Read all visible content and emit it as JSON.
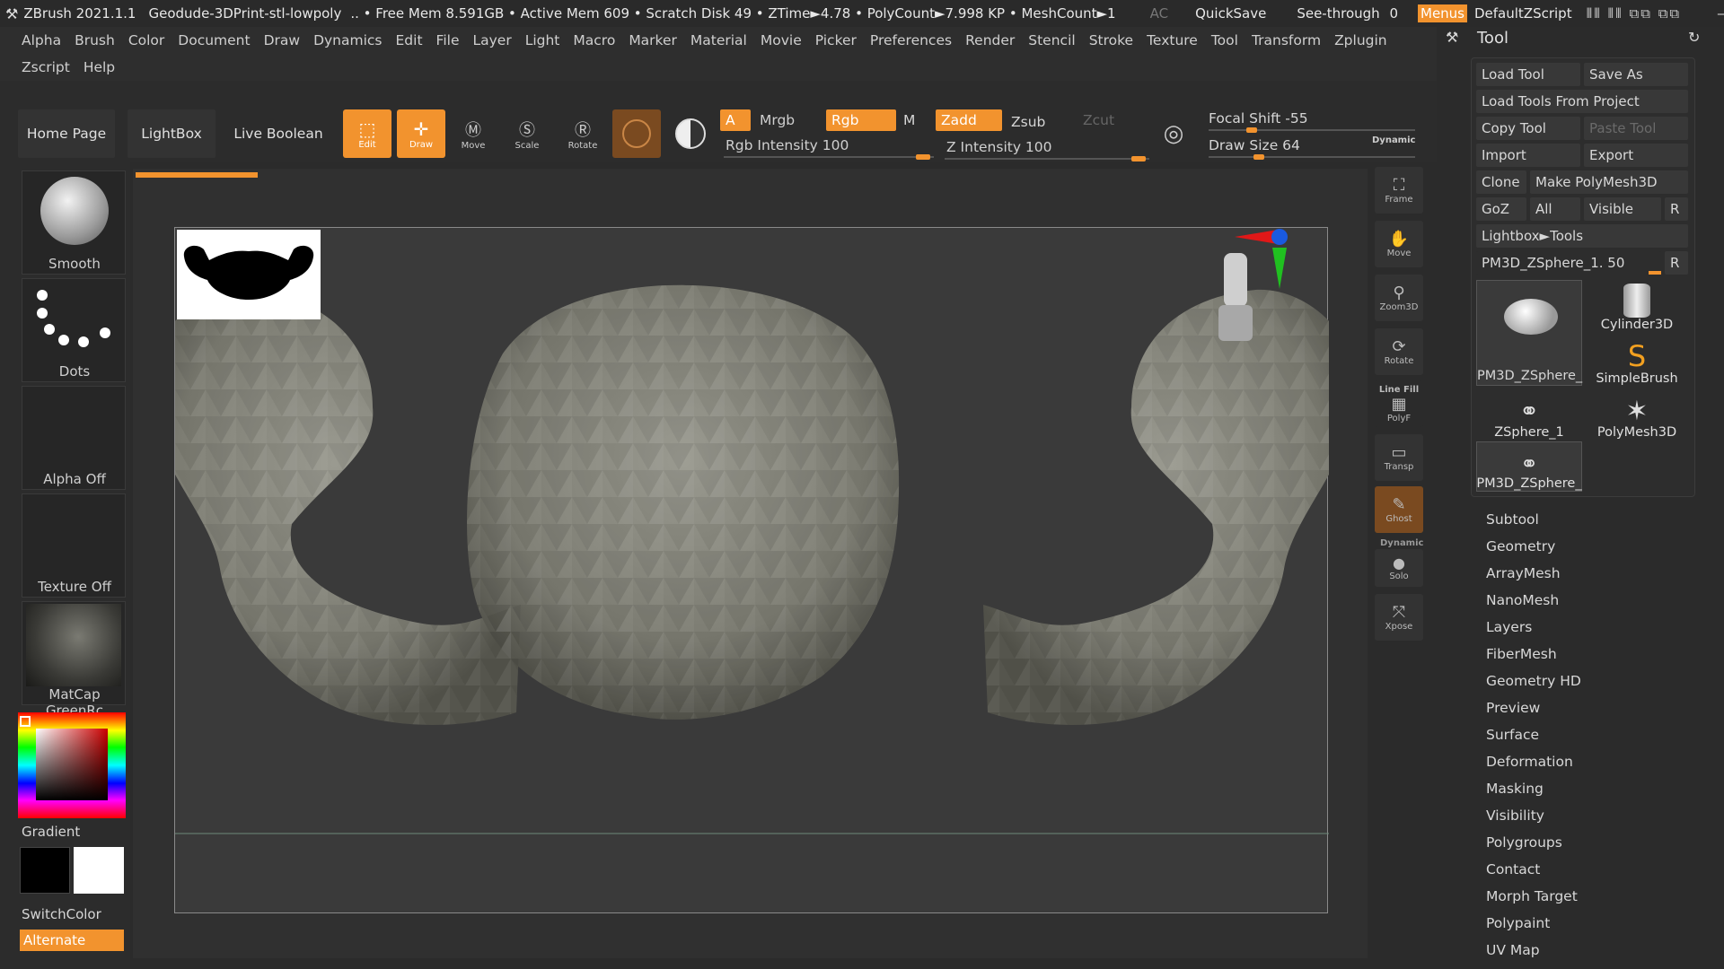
{
  "titlebar": {
    "app": "ZBrush 2021.1.1",
    "document": "Geodude-3DPrint-stl-lowpoly",
    "stats": ".. • Free Mem 8.591GB • Active Mem 609 • Scratch Disk 49 • ZTime►4.78 • PolyCount►7.998 KP • MeshCount►1",
    "ac": "AC",
    "quicksave": "QuickSave",
    "see_through_label": "See-through",
    "see_through_value": "0",
    "menus": "Menus",
    "script": "DefaultZScript"
  },
  "menu_row1": [
    "Alpha",
    "Brush",
    "Color",
    "Document",
    "Draw",
    "Dynamics",
    "Edit",
    "File",
    "Layer",
    "Light",
    "Macro",
    "Marker",
    "Material",
    "Movie",
    "Picker",
    "Preferences",
    "Render",
    "Stencil",
    "Stroke",
    "Texture",
    "Tool",
    "Transform",
    "Zplugin"
  ],
  "menu_row2": [
    "Zscript",
    "Help"
  ],
  "toolbar": {
    "home": "Home Page",
    "lightbox": "LightBox",
    "live_boolean": "Live Boolean",
    "edit": "Edit",
    "draw": "Draw",
    "move": "Move",
    "scale": "Scale",
    "rotate": "Rotate",
    "a": "A",
    "mrgb": "Mrgb",
    "rgb": "Rgb",
    "m": "M",
    "zadd": "Zadd",
    "zsub": "Zsub",
    "zcut": "Zcut",
    "rgb_intensity": "Rgb Intensity 100",
    "z_intensity": "Z Intensity 100",
    "focal_shift": "Focal Shift -55",
    "draw_size": "Draw Size 64",
    "dynamic": "Dynamic"
  },
  "left": {
    "smooth": "Smooth",
    "dots": "Dots",
    "alpha_off": "Alpha Off",
    "texture_off": "Texture Off",
    "matcap": "MatCap GreenRc",
    "gradient": "Gradient",
    "switchcolor": "SwitchColor",
    "alternate": "Alternate"
  },
  "right_strip": [
    "Frame",
    "Move",
    "Zoom3D",
    "Rotate",
    "Line Fill",
    "PolyF",
    "Transp",
    "Ghost",
    "Dynamic",
    "Solo",
    "Xpose"
  ],
  "tool_panel": {
    "title": "Tool",
    "load_tool": "Load Tool",
    "save_as": "Save As",
    "load_from_project": "Load Tools From Project",
    "copy_tool": "Copy Tool",
    "paste_tool": "Paste Tool",
    "import": "Import",
    "export": "Export",
    "clone": "Clone",
    "make_polymesh": "Make PolyMesh3D",
    "goz": "GoZ",
    "all": "All",
    "visible": "Visible",
    "r": "R",
    "lightbox_tools": "Lightbox►Tools",
    "current_tool": "PM3D_ZSphere_1. 50",
    "thumbs": [
      "PM3D_ZSphere_",
      "Cylinder3D",
      "SimpleBrush",
      "ZSphere_1",
      "PolyMesh3D",
      "PM3D_ZSphere_"
    ],
    "sections": [
      "Subtool",
      "Geometry",
      "ArrayMesh",
      "NanoMesh",
      "Layers",
      "FiberMesh",
      "Geometry HD",
      "Preview",
      "Surface",
      "Deformation",
      "Masking",
      "Visibility",
      "Polygroups",
      "Contact",
      "Morph Target",
      "Polypaint",
      "UV Map"
    ]
  },
  "colors": {
    "accent": "#f2932e",
    "bg": "#2b2b2b",
    "mesh": "#8a8a80"
  }
}
